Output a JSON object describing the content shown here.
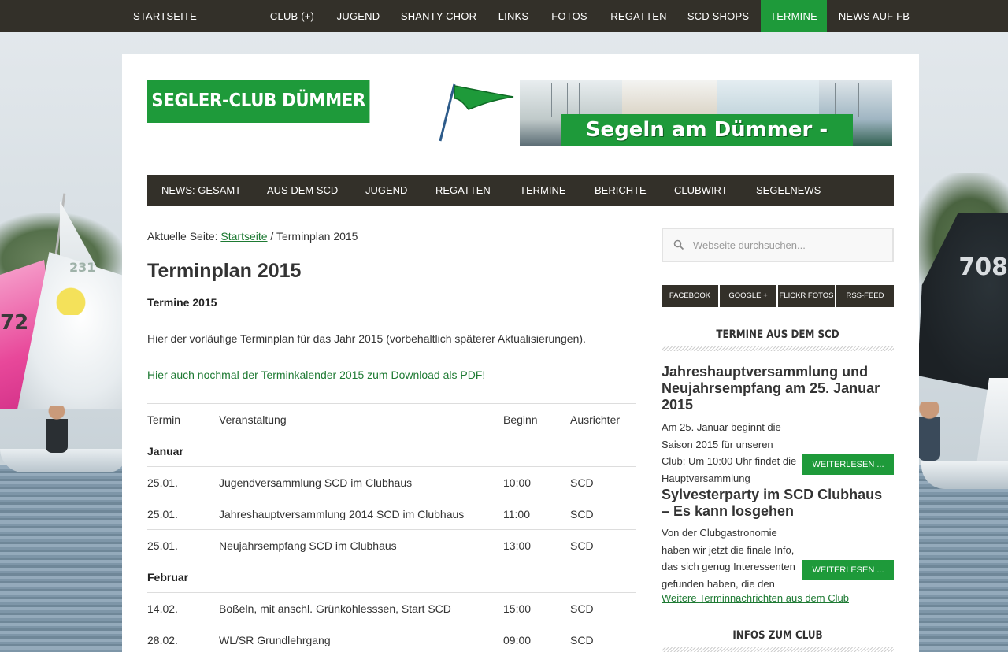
{
  "topnav": {
    "items": [
      {
        "label": "STARTSEITE"
      },
      {
        "label": "CLUB (+)"
      },
      {
        "label": "JUGEND"
      },
      {
        "label": "SHANTY-CHOR"
      },
      {
        "label": "LINKS"
      },
      {
        "label": "FOTOS"
      },
      {
        "label": "REGATTEN"
      },
      {
        "label": "SCD SHOPS"
      },
      {
        "label": "TERMINE"
      },
      {
        "label": "NEWS AUF FB"
      }
    ],
    "active": "TERMINE"
  },
  "header": {
    "logo_text": "SEGLER-CLUB DÜMMER E.V.",
    "banner_text": "Segeln am Dümmer - SCD"
  },
  "subnav": {
    "items": [
      {
        "label": "NEWS: GESAMT"
      },
      {
        "label": "AUS DEM SCD"
      },
      {
        "label": "JUGEND"
      },
      {
        "label": "REGATTEN"
      },
      {
        "label": "TERMINE"
      },
      {
        "label": "BERICHTE"
      },
      {
        "label": "CLUBWIRT"
      },
      {
        "label": "SEGELNEWS"
      }
    ]
  },
  "breadcrumb": {
    "prefix": "Aktuelle Seite: ",
    "home": "Startseite",
    "separator": " / ",
    "current": "Terminplan 2015"
  },
  "content": {
    "title": "Terminplan 2015",
    "subtitle": "Termine 2015",
    "intro": "Hier der vorläufige Terminplan für das Jahr 2015 (vorbehaltlich späterer Aktualisierungen).",
    "pdf_link": "Hier auch nochmal der Terminkalender 2015 zum Download als PDF!"
  },
  "table": {
    "headers": [
      "Termin",
      "Veranstaltung",
      "Beginn",
      "Ausrichter"
    ],
    "rows": [
      {
        "type": "month",
        "label": "Januar"
      },
      {
        "type": "event",
        "date": "25.01.",
        "event": "Jugendversammlung SCD im Clubhaus",
        "time": "10:00",
        "host": "SCD"
      },
      {
        "type": "event",
        "date": "25.01.",
        "event": "Jahreshauptversammlung 2014 SCD im Clubhaus",
        "time": "11:00",
        "host": "SCD"
      },
      {
        "type": "event",
        "date": "25.01.",
        "event": "Neujahrsempfang SCD im Clubhaus",
        "time": "13:00",
        "host": "SCD"
      },
      {
        "type": "month",
        "label": "Februar"
      },
      {
        "type": "event",
        "date": "14.02.",
        "event": "Boßeln, mit anschl. Grünkohlesssen, Start SCD",
        "time": "15:00",
        "host": "SCD"
      },
      {
        "type": "event",
        "date": "28.02.",
        "event": "WL/SR Grundlehrgang",
        "time": "09:00",
        "host": "SCD"
      }
    ]
  },
  "sidebar": {
    "search_placeholder": "Webseite durchsuchen...",
    "social": [
      "FACEBOOK",
      "GOOGLE +",
      "FLICKR FOTOS",
      "RSS-FEED"
    ],
    "widget1_title": "TERMINE AUS DEM SCD",
    "posts": [
      {
        "title": "Jahreshauptversammlung und Neujahrsempfang am 25. Januar 2015",
        "excerpt": "  Am 25. Januar beginnt die Saison 2015 für unseren Club: Um 10:00 Uhr findet die Hauptversammlung",
        "more": "WEITERLESEN ..."
      },
      {
        "title": "Sylvesterparty im SCD Clubhaus – Es kann losgehen",
        "excerpt": "Von der Clubgastronomie haben wir jetzt die finale Info, das sich genug Interessenten gefunden haben, die den",
        "more": "WEITERLESEN ..."
      }
    ],
    "more_link": "Weitere Terminnachrichten aus dem Club",
    "widget2_title": "INFOS ZUM CLUB"
  },
  "background": {
    "sail_number_left": "72",
    "sail_number_left2": "231",
    "sail_number_right": "708"
  },
  "colors": {
    "accent_green": "#1e9a3a",
    "nav_dark": "#333029",
    "link_green": "#1e7a33"
  }
}
